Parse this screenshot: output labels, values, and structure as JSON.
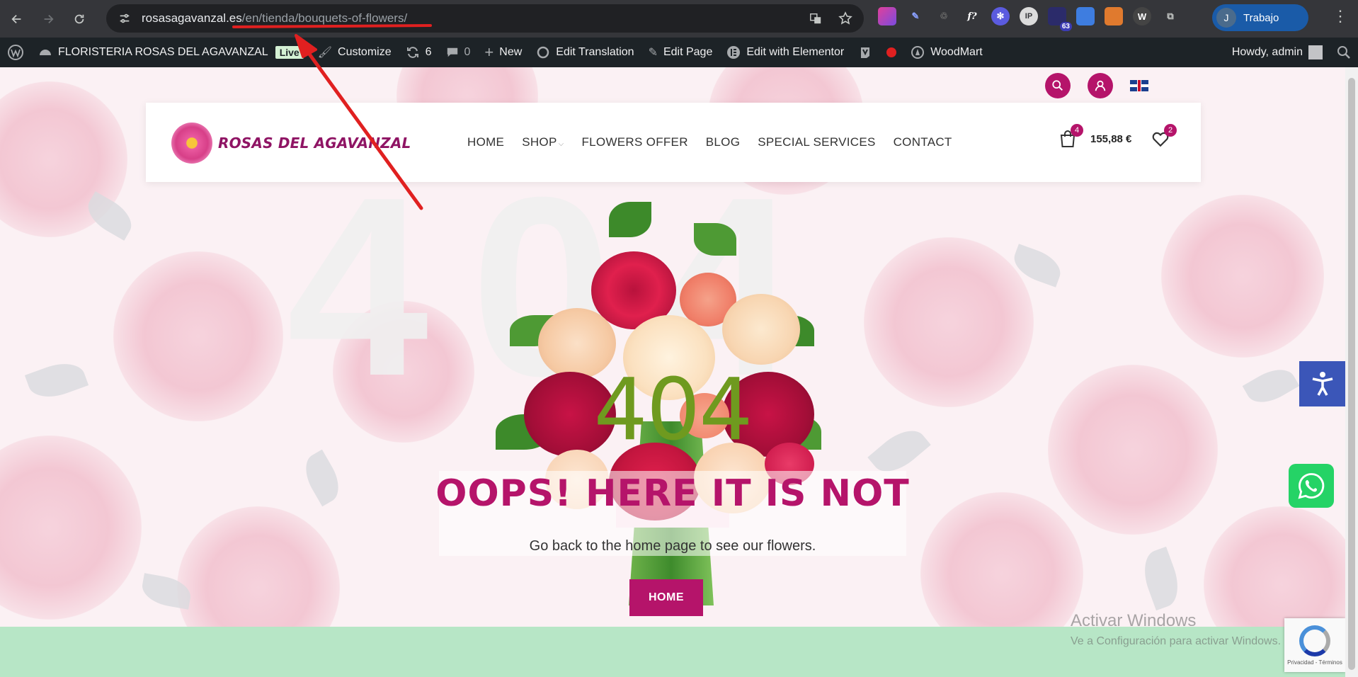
{
  "browser": {
    "url_host": "rosasagavanzal.es",
    "url_path": "/en/tienda/bouquets-of-flowers/",
    "profile_initial": "J",
    "profile_label": "Trabajo",
    "ext_badge": "63"
  },
  "wpbar": {
    "site_name": "FLORISTERIA ROSAS DEL AGAVANZAL",
    "live": "Live",
    "customize": "Customize",
    "updates": "6",
    "comments": "0",
    "new": "New",
    "edit_translation": "Edit Translation",
    "edit_page": "Edit Page",
    "edit_elementor": "Edit with Elementor",
    "woodmart": "WoodMart",
    "howdy": "Howdy, admin"
  },
  "site": {
    "logo_text": "ROSAS DEL AGAVANZAL",
    "menu": [
      "HOME",
      "SHOP",
      "FLOWERS OFFER",
      "BLOG",
      "SPECIAL SERVICES",
      "CONTACT"
    ],
    "cart_count": "4",
    "cart_total": "155,88 €",
    "wishlist_count": "2"
  },
  "error": {
    "code": "404",
    "bg_code": "404",
    "title": "OOPS! HERE IT IS NOT",
    "subtitle": "Go back to the home page to see our flowers.",
    "button": "HOME"
  },
  "overlay": {
    "activate_title": "Activar Windows",
    "activate_sub": "Ve a Configuración para activar Windows.",
    "recaptcha_text": "Privacidad - Términos"
  },
  "colors": {
    "brand": "#b5146a",
    "error_code": "#6f9a1f",
    "footer": "#b7e6c6",
    "annotation": "#e02020"
  }
}
